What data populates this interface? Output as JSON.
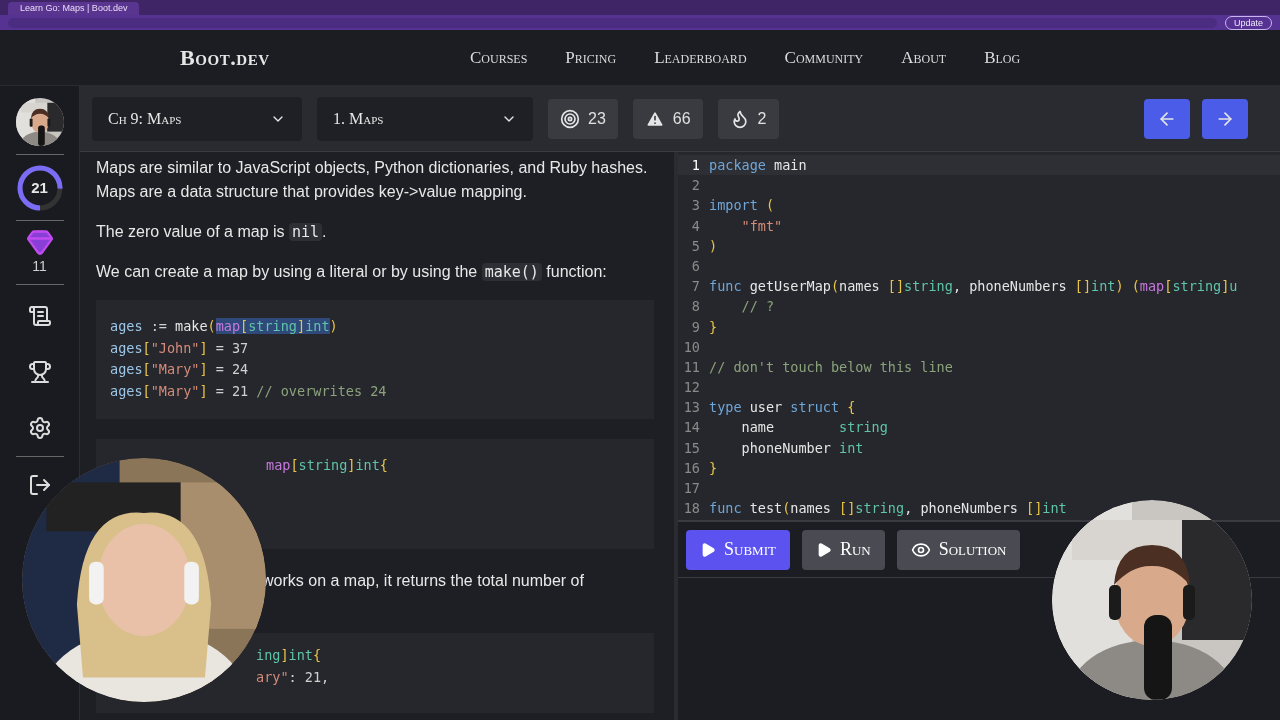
{
  "browser": {
    "tab_title": "Learn Go: Maps | Boot.dev",
    "update_button": "Update"
  },
  "nav": {
    "logo": "Boot.dev",
    "links": [
      {
        "label": "Courses"
      },
      {
        "label": "Pricing"
      },
      {
        "label": "Leaderboard"
      },
      {
        "label": "Community"
      },
      {
        "label": "About"
      },
      {
        "label": "Blog"
      }
    ]
  },
  "sidebar": {
    "level": {
      "value": "21",
      "level": 0.75
    },
    "gems": "11"
  },
  "toolbar": {
    "chapter": "Ch 9: Maps",
    "lesson": "1. Maps",
    "stats": [
      {
        "kind": "target",
        "value": "23"
      },
      {
        "kind": "warning",
        "value": "66"
      },
      {
        "kind": "flame",
        "value": "2"
      }
    ]
  },
  "lesson": {
    "paragraphs": [
      [
        {
          "text": "Maps are similar to JavaScript objects, Python dictionaries, and Ruby hashes. Maps are a data structure that provides key->value mapping.",
          "kind": "text"
        }
      ],
      [
        {
          "text": "The zero value of a map is ",
          "kind": "text"
        },
        {
          "text": "nil",
          "kind": "code"
        },
        {
          "text": ".",
          "kind": "text"
        }
      ],
      [
        {
          "text": "We can create a map by using a literal or by using the ",
          "kind": "text"
        },
        {
          "text": "make()",
          "kind": "code"
        },
        {
          "text": " function:",
          "kind": "text"
        }
      ]
    ],
    "code_block": [
      [
        {
          "text": "ages",
          "kind": "var",
          "hl": false
        },
        {
          "text": " := ",
          "kind": "op",
          "hl": false
        },
        {
          "text": "make",
          "kind": "fn",
          "hl": false
        },
        {
          "text": "(",
          "kind": "br",
          "hl": false
        },
        {
          "text": "map",
          "kind": "map",
          "hl": true
        },
        {
          "text": "[",
          "kind": "br",
          "hl": true
        },
        {
          "text": "string",
          "kind": "type",
          "hl": true
        },
        {
          "text": "]",
          "kind": "br",
          "hl": true
        },
        {
          "text": "int",
          "kind": "type",
          "hl": true
        },
        {
          "text": ")",
          "kind": "br",
          "hl": false
        }
      ],
      [
        {
          "text": "ages",
          "kind": "var"
        },
        {
          "text": "[",
          "kind": "br"
        },
        {
          "text": "\"John\"",
          "kind": "str"
        },
        {
          "text": "]",
          "kind": "br"
        },
        {
          "text": " = 37",
          "kind": "op"
        }
      ],
      [
        {
          "text": "ages",
          "kind": "var"
        },
        {
          "text": "[",
          "kind": "br"
        },
        {
          "text": "\"Mary\"",
          "kind": "str"
        },
        {
          "text": "]",
          "kind": "br"
        },
        {
          "text": " = 24",
          "kind": "op"
        }
      ],
      [
        {
          "text": "ages",
          "kind": "var"
        },
        {
          "text": "[",
          "kind": "br"
        },
        {
          "text": "\"Mary\"",
          "kind": "str"
        },
        {
          "text": "]",
          "kind": "br"
        },
        {
          "text": " = 21 ",
          "kind": "op"
        },
        {
          "text": "// overwrites 24",
          "kind": "cmt"
        }
      ]
    ],
    "partial_block_1": [
      {
        "text": "map",
        "kind": "map"
      },
      {
        "text": "[",
        "kind": "br"
      },
      {
        "text": "string",
        "kind": "type"
      },
      {
        "text": "]",
        "kind": "br"
      },
      {
        "text": "int",
        "kind": "type"
      },
      {
        "text": "{",
        "kind": "br"
      }
    ],
    "partial_text": "works on a map, it returns the total number of",
    "partial_block_2": [
      [
        {
          "text": "ing",
          "kind": "type"
        },
        {
          "text": "]",
          "kind": "br"
        },
        {
          "text": "int",
          "kind": "type"
        },
        {
          "text": "{",
          "kind": "br"
        }
      ],
      [
        {
          "text": "ary\"",
          "kind": "str"
        },
        {
          "text": ": 21,",
          "kind": "op"
        }
      ]
    ]
  },
  "editor": {
    "lines": [
      {
        "n": "1",
        "active": true,
        "tokens": [
          {
            "text": "package",
            "kind": "kw"
          },
          {
            "text": " main",
            "kind": "plain"
          }
        ]
      },
      {
        "n": "2",
        "active": false
      },
      {
        "n": "3",
        "active": false,
        "tokens": [
          {
            "text": "import",
            "kind": "kw"
          },
          {
            "text": " (",
            "kind": "br"
          }
        ]
      },
      {
        "n": "4",
        "active": false,
        "tokens": [
          {
            "text": "    \"fmt\"",
            "kind": "str"
          }
        ]
      },
      {
        "n": "5",
        "active": false,
        "tokens": [
          {
            "text": ")",
            "kind": "br"
          }
        ]
      },
      {
        "n": "6",
        "active": false
      },
      {
        "n": "7",
        "active": false,
        "tokens": [
          {
            "text": "func",
            "kind": "kw"
          },
          {
            "text": " getUserMap",
            "kind": "plain"
          },
          {
            "text": "(",
            "kind": "br"
          },
          {
            "text": "names ",
            "kind": "plain"
          },
          {
            "text": "[]",
            "kind": "br"
          },
          {
            "text": "string",
            "kind": "type"
          },
          {
            "text": ", phoneNumbers ",
            "kind": "plain"
          },
          {
            "text": "[]",
            "kind": "br"
          },
          {
            "text": "int",
            "kind": "type"
          },
          {
            "text": ") (",
            "kind": "br"
          },
          {
            "text": "map",
            "kind": "map"
          },
          {
            "text": "[",
            "kind": "br"
          },
          {
            "text": "string",
            "kind": "type"
          },
          {
            "text": "]",
            "kind": "br"
          },
          {
            "text": "u",
            "kind": "type"
          }
        ]
      },
      {
        "n": "8",
        "active": false,
        "tokens": [
          {
            "text": "    // ?",
            "kind": "cmt"
          }
        ]
      },
      {
        "n": "9",
        "active": false,
        "tokens": [
          {
            "text": "}",
            "kind": "br"
          }
        ]
      },
      {
        "n": "10",
        "active": false
      },
      {
        "n": "11",
        "active": false,
        "tokens": [
          {
            "text": "// don't touch below this line",
            "kind": "cmt"
          }
        ]
      },
      {
        "n": "12",
        "active": false
      },
      {
        "n": "13",
        "active": false,
        "tokens": [
          {
            "text": "type",
            "kind": "kw"
          },
          {
            "text": " user ",
            "kind": "plain"
          },
          {
            "text": "struct",
            "kind": "kw"
          },
          {
            "text": " {",
            "kind": "br"
          }
        ]
      },
      {
        "n": "14",
        "active": false,
        "tokens": [
          {
            "text": "    name        ",
            "kind": "plain"
          },
          {
            "text": "string",
            "kind": "type"
          }
        ]
      },
      {
        "n": "15",
        "active": false,
        "tokens": [
          {
            "text": "    phoneNumber ",
            "kind": "plain"
          },
          {
            "text": "int",
            "kind": "type"
          }
        ]
      },
      {
        "n": "16",
        "active": false,
        "tokens": [
          {
            "text": "}",
            "kind": "br"
          }
        ]
      },
      {
        "n": "17",
        "active": false
      },
      {
        "n": "18",
        "active": false,
        "tokens": [
          {
            "text": "func",
            "kind": "kw"
          },
          {
            "text": " test",
            "kind": "plain"
          },
          {
            "text": "(",
            "kind": "br"
          },
          {
            "text": "names ",
            "kind": "plain"
          },
          {
            "text": "[]",
            "kind": "br"
          },
          {
            "text": "string",
            "kind": "type"
          },
          {
            "text": ", phoneNumbers ",
            "kind": "plain"
          },
          {
            "text": "[]",
            "kind": "br"
          },
          {
            "text": "int",
            "kind": "type"
          }
        ]
      }
    ]
  },
  "actions": [
    {
      "kind": "submit",
      "label": "Submit"
    },
    {
      "kind": "run",
      "label": "Run"
    },
    {
      "kind": "solution",
      "label": "Solution"
    }
  ]
}
